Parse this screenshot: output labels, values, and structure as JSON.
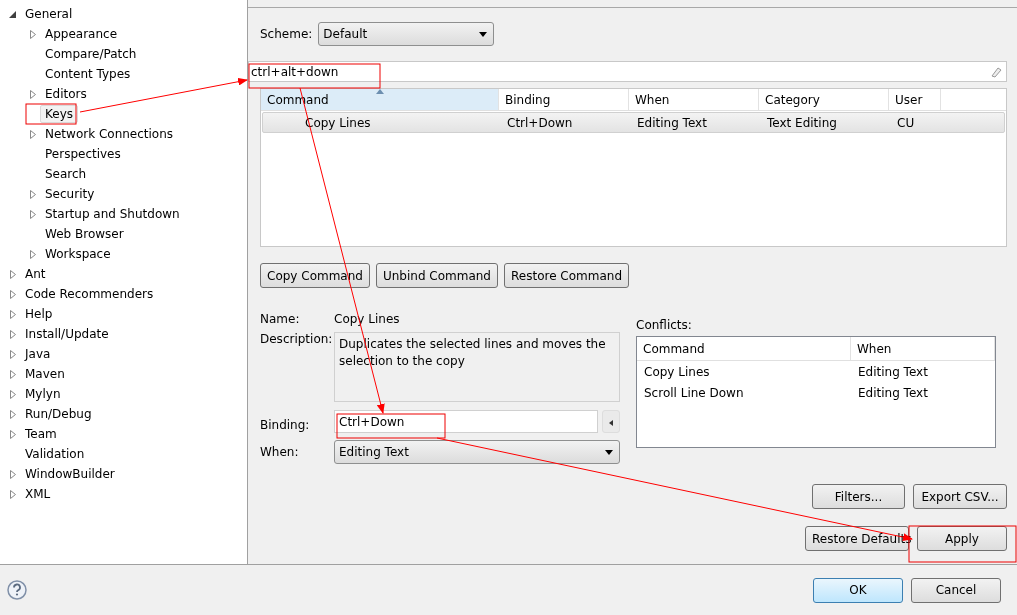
{
  "tree": [
    {
      "label": "General",
      "kind": "branch",
      "expanded": true,
      "selected": false,
      "children": [
        {
          "label": "Appearance",
          "kind": "branch",
          "expanded": false,
          "selected": false
        },
        {
          "label": "Compare/Patch",
          "kind": "leaf",
          "selected": false
        },
        {
          "label": "Content Types",
          "kind": "leaf",
          "selected": false
        },
        {
          "label": "Editors",
          "kind": "branch",
          "expanded": false,
          "selected": false
        },
        {
          "label": "Keys",
          "kind": "leaf",
          "selected": true
        },
        {
          "label": "Network Connections",
          "kind": "branch",
          "expanded": false,
          "selected": false
        },
        {
          "label": "Perspectives",
          "kind": "leaf",
          "selected": false
        },
        {
          "label": "Search",
          "kind": "leaf",
          "selected": false
        },
        {
          "label": "Security",
          "kind": "branch",
          "expanded": false,
          "selected": false
        },
        {
          "label": "Startup and Shutdown",
          "kind": "branch",
          "expanded": false,
          "selected": false
        },
        {
          "label": "Web Browser",
          "kind": "leaf",
          "selected": false
        },
        {
          "label": "Workspace",
          "kind": "branch",
          "expanded": false,
          "selected": false
        }
      ]
    },
    {
      "label": "Ant",
      "kind": "branch",
      "expanded": false,
      "selected": false
    },
    {
      "label": "Code Recommenders",
      "kind": "branch",
      "expanded": false,
      "selected": false
    },
    {
      "label": "Help",
      "kind": "branch",
      "expanded": false,
      "selected": false
    },
    {
      "label": "Install/Update",
      "kind": "branch",
      "expanded": false,
      "selected": false
    },
    {
      "label": "Java",
      "kind": "branch",
      "expanded": false,
      "selected": false
    },
    {
      "label": "Maven",
      "kind": "branch",
      "expanded": false,
      "selected": false
    },
    {
      "label": "Mylyn",
      "kind": "branch",
      "expanded": false,
      "selected": false
    },
    {
      "label": "Run/Debug",
      "kind": "branch",
      "expanded": false,
      "selected": false
    },
    {
      "label": "Team",
      "kind": "branch",
      "expanded": false,
      "selected": false
    },
    {
      "label": "Validation",
      "kind": "leaf",
      "selected": false
    },
    {
      "label": "WindowBuilder",
      "kind": "branch",
      "expanded": false,
      "selected": false
    },
    {
      "label": "XML",
      "kind": "branch",
      "expanded": false,
      "selected": false
    }
  ],
  "scheme": {
    "label": "Scheme:",
    "value": "Default"
  },
  "filter": {
    "value": "ctrl+alt+down"
  },
  "table": {
    "columns": [
      {
        "label": "Command",
        "sorted": true
      },
      {
        "label": "Binding",
        "sorted": false
      },
      {
        "label": "When",
        "sorted": false
      },
      {
        "label": "Category",
        "sorted": false
      },
      {
        "label": "User",
        "sorted": false
      }
    ],
    "rows": [
      {
        "selected": true,
        "cells": [
          "Copy Lines",
          "Ctrl+Down",
          "Editing Text",
          "Text Editing",
          "CU"
        ]
      }
    ]
  },
  "command_buttons": [
    "Copy Command",
    "Unbind Command",
    "Restore Command"
  ],
  "details": {
    "name_label": "Name:",
    "name": "Copy Lines",
    "description_label": "Description:",
    "description": "Duplicates the selected lines and moves the selection to the copy",
    "binding_label": "Binding:",
    "binding": "Ctrl+Down",
    "when_label": "When:",
    "when": "Editing Text"
  },
  "conflicts": {
    "label": "Conflicts:",
    "columns": [
      "Command",
      "When"
    ],
    "rows": [
      [
        "Copy Lines",
        "Editing Text"
      ],
      [
        "Scroll Line Down",
        "Editing Text"
      ]
    ]
  },
  "list_buttons": [
    "Filters...",
    "Export CSV..."
  ],
  "page_buttons": [
    "Restore Defaults",
    "Apply"
  ],
  "dialog_buttons": [
    {
      "label": "OK",
      "default": true
    },
    {
      "label": "Cancel",
      "default": false
    }
  ]
}
